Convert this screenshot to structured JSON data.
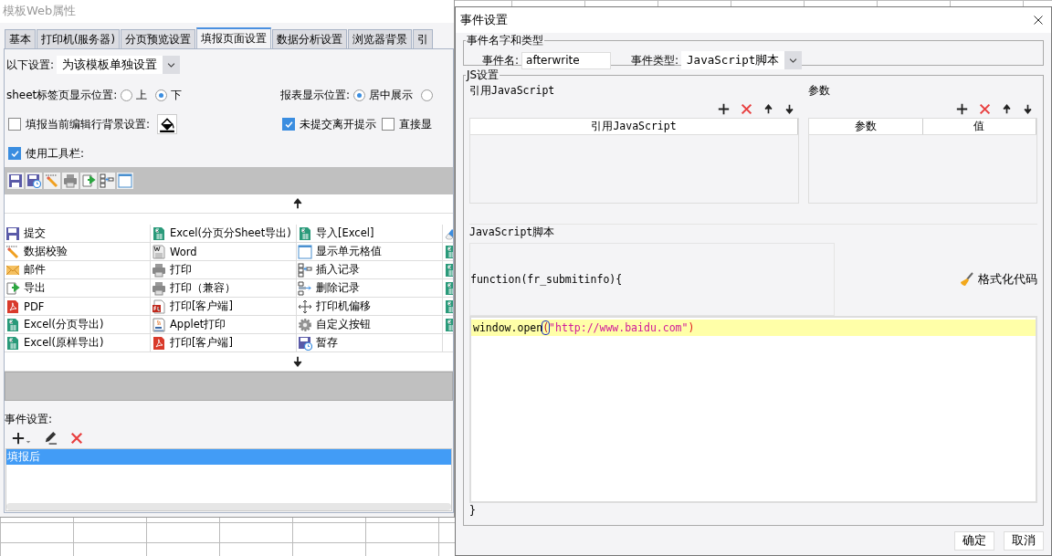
{
  "back_window": {
    "title": "模板Web属性",
    "tabs": [
      {
        "label": "基本",
        "selected": false
      },
      {
        "label": "打印机(服务器)",
        "selected": false
      },
      {
        "label": "分页预览设置",
        "selected": false
      },
      {
        "label": "填报页面设置",
        "selected": true
      },
      {
        "label": "数据分析设置",
        "selected": false
      },
      {
        "label": "浏览器背景",
        "selected": false
      },
      {
        "label": "引",
        "selected": false
      }
    ],
    "scope": {
      "label": "以下设置:",
      "value": "为该模板单独设置"
    },
    "sheet_tab_position": {
      "label": "sheet标签页显示位置:",
      "options": [
        {
          "label": "上",
          "selected": false
        },
        {
          "label": "下",
          "selected": true
        }
      ]
    },
    "report_position": {
      "label": "报表显示位置:",
      "options": [
        {
          "label": "居中展示",
          "selected": true
        },
        {
          "selected": false
        }
      ]
    },
    "edit_row_background": {
      "label": "填报当前编辑行背景设置:",
      "checked": false
    },
    "leave_prompt": {
      "label": "未提交离开提示",
      "checked": true
    },
    "direct_show": {
      "label": "直接显",
      "checked": false
    },
    "use_toolbar": {
      "label": "使用工具栏:",
      "checked": true
    },
    "button_grid": {
      "rows": [
        [
          "提交",
          "Excel(分页分Sheet导出)",
          "导入[Excel]"
        ],
        [
          "数据校验",
          "Word",
          "显示单元格值"
        ],
        [
          "邮件",
          "打印",
          "插入记录"
        ],
        [
          "导出",
          "打印（兼容）",
          "删除记录"
        ],
        [
          "PDF",
          "打印[客户端]",
          "打印机偏移"
        ],
        [
          "Excel(分页导出)",
          "Applet打印",
          "自定义按钮"
        ],
        [
          "Excel(原样导出)",
          "打印[客户端]",
          "暂存"
        ]
      ]
    },
    "events": {
      "label": "事件设置:",
      "items": [
        {
          "label": "填报后",
          "selected": true
        }
      ]
    }
  },
  "dialog": {
    "title": "事件设置",
    "name_group": {
      "title": "事件名字和类型",
      "name_label": "事件名:",
      "name_value": "afterwrite",
      "type_label": "事件类型:",
      "type_value": "JavaScript脚本"
    },
    "js_group": {
      "title": "JS设置",
      "ref_js": {
        "title": "引用JavaScript",
        "columns": [
          "引用JavaScript"
        ]
      },
      "params": {
        "title": "参数",
        "columns": [
          "参数",
          "值"
        ]
      },
      "script": {
        "title": "JavaScript脚本",
        "header": "function(fr_submitinfo){",
        "format_button": "格式化代码",
        "code_lines": [
          [
            {
              "kind": "plain",
              "text": "window.open"
            },
            {
              "kind": "bracket",
              "text": "("
            },
            {
              "kind": "string",
              "text": "\"http://www.baidu.com\""
            },
            {
              "kind": "paren",
              "text": ")"
            }
          ]
        ],
        "footer": "}"
      }
    },
    "buttons": [
      "确定",
      "取消"
    ]
  }
}
